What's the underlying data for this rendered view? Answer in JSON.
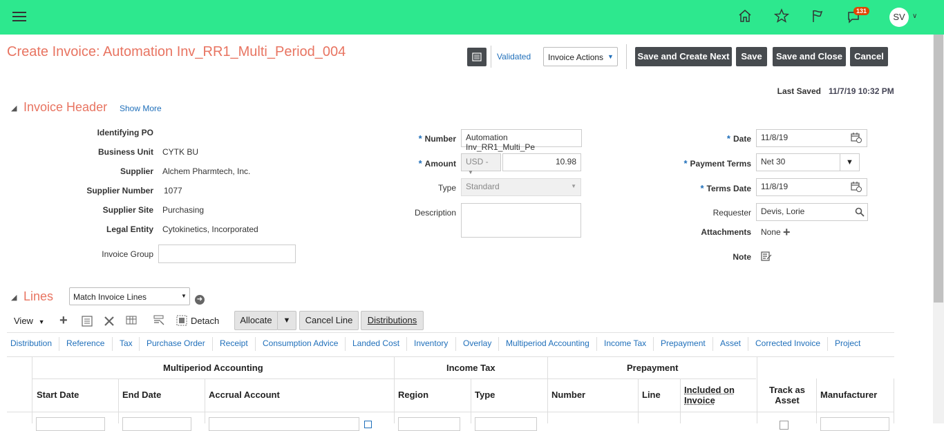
{
  "topbar": {
    "notification_count": "131",
    "user_initials": "SV"
  },
  "page": {
    "title": "Create Invoice: Automation Inv_RR1_Multi_Period_004"
  },
  "toolbar": {
    "validated": "Validated",
    "invoice_actions": "Invoice Actions",
    "save_create_next": "Save and Create Next",
    "save": "Save",
    "save_close": "Save and Close",
    "cancel": "Cancel"
  },
  "last_saved": {
    "label": "Last Saved",
    "value": "11/7/19 10:32 PM"
  },
  "header": {
    "title": "Invoice Header",
    "show_more": "Show More",
    "left": [
      {
        "label": "Identifying PO",
        "value": ""
      },
      {
        "label": "Business Unit",
        "value": "CYTK BU"
      },
      {
        "label": "Supplier",
        "value": "Alchem Pharmtech, Inc."
      },
      {
        "label": "Supplier Number",
        "value": "1077"
      },
      {
        "label": "Supplier Site",
        "value": "Purchasing"
      },
      {
        "label": "Legal Entity",
        "value": "Cytokinetics, Incorporated"
      }
    ],
    "invoice_group_label": "Invoice Group",
    "number_label": "Number",
    "number_value": "Automation Inv_RR1_Multi_Pe",
    "amount_label": "Amount",
    "currency": "USD -",
    "amount_value": "10.98",
    "type_label": "Type",
    "type_value": "Standard",
    "description_label": "Description",
    "date_label": "Date",
    "date_value": "11/8/19",
    "payment_terms_label": "Payment Terms",
    "payment_terms_value": "Net 30",
    "terms_date_label": "Terms Date",
    "terms_date_value": "11/8/19",
    "requester_label": "Requester",
    "requester_value": "Devis, Lorie",
    "attachments_label": "Attachments",
    "attachments_value": "None",
    "note_label": "Note"
  },
  "lines": {
    "title": "Lines",
    "match_select": "Match Invoice Lines",
    "view": "View",
    "detach": "Detach",
    "allocate": "Allocate",
    "cancel_line": "Cancel Line",
    "distributions": "Distributions",
    "tabs": [
      "Distribution",
      "Reference",
      "Tax",
      "Purchase Order",
      "Receipt",
      "Consumption Advice",
      "Landed Cost",
      "Inventory",
      "Overlay",
      "Multiperiod Accounting",
      "Income Tax",
      "Prepayment",
      "Asset",
      "Corrected Invoice",
      "Project"
    ],
    "groups": {
      "multiperiod": "Multiperiod Accounting",
      "income_tax": "Income Tax",
      "prepayment": "Prepayment"
    },
    "columns": [
      "Start Date",
      "End Date",
      "Accrual Account",
      "Region",
      "Type",
      "Number",
      "Line",
      "Included on Invoice",
      "Track as Asset",
      "Manufacturer"
    ]
  }
}
